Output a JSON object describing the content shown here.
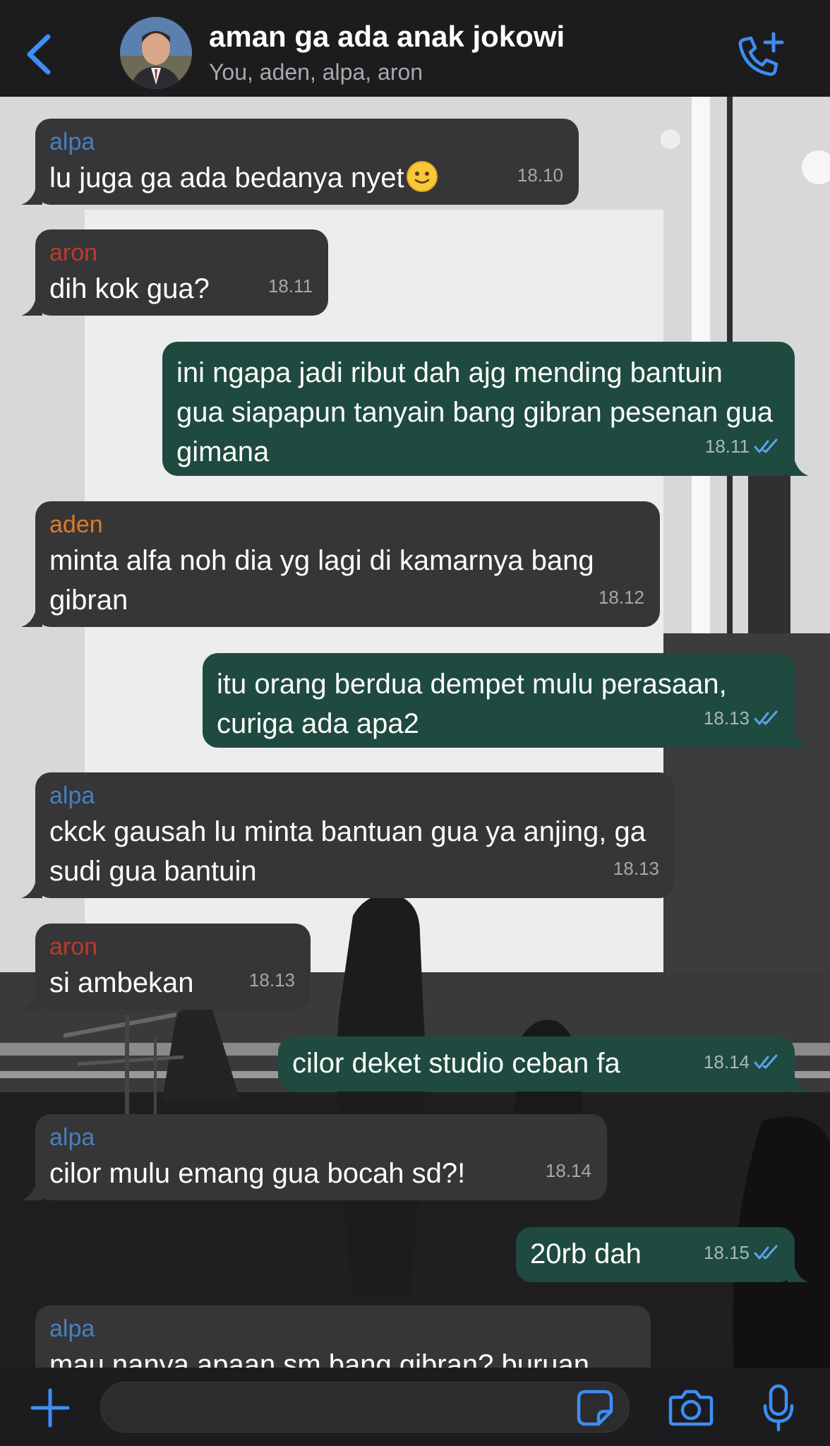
{
  "header": {
    "title": "aman ga ada anak jokowi",
    "subtitle": "You, aden, alpa, aron",
    "back_icon": "chevron-left-icon",
    "call_icon": "phone-add-icon"
  },
  "colors": {
    "accent": "#3d8ef5",
    "incoming_bubble": "#363638",
    "outgoing_bubble": "#1f4a3f",
    "sender_alpa": "#4a7fbd",
    "sender_aron": "#c0392b",
    "sender_aden": "#e07b24",
    "read_ticks": "#5aa5f0"
  },
  "messages": [
    {
      "dir": "in",
      "sender": "alpa",
      "text": "lu juga ga ada bedanya nyet",
      "emoji": "slightly-smiling-face",
      "time": "18.10"
    },
    {
      "dir": "in",
      "sender": "aron",
      "text": "dih kok gua?",
      "time": "18.11"
    },
    {
      "dir": "out",
      "text": "ini ngapa jadi ribut dah ajg mending bantuin gua siapapun tanyain bang gibran pesenan gua gimana",
      "time": "18.11",
      "status": "read"
    },
    {
      "dir": "in",
      "sender": "aden",
      "text": "minta alfa noh dia yg lagi di kamarnya bang gibran",
      "time": "18.12"
    },
    {
      "dir": "out",
      "text": "itu orang berdua dempet mulu perasaan, curiga ada apa2",
      "time": "18.13",
      "status": "read"
    },
    {
      "dir": "in",
      "sender": "alpa",
      "text": "ckck gausah lu minta bantuan gua ya anjing, ga sudi gua bantuin",
      "time": "18.13"
    },
    {
      "dir": "in",
      "sender": "aron",
      "text": "si ambekan",
      "time": "18.13"
    },
    {
      "dir": "out",
      "text": "cilor deket studio ceban fa",
      "time": "18.14",
      "status": "read"
    },
    {
      "dir": "in",
      "sender": "alpa",
      "text": "cilor mulu emang gua bocah sd?!",
      "time": "18.14"
    },
    {
      "dir": "out",
      "text": "20rb dah",
      "time": "18.15",
      "status": "read"
    },
    {
      "dir": "in",
      "sender": "alpa",
      "text": "mau nanya apaan sm bang gibran? buruan",
      "time": ""
    }
  ],
  "composer": {
    "input_value": "",
    "plus_icon": "plus-icon",
    "sticker_icon": "sticker-icon",
    "camera_icon": "camera-icon",
    "mic_icon": "microphone-icon"
  }
}
